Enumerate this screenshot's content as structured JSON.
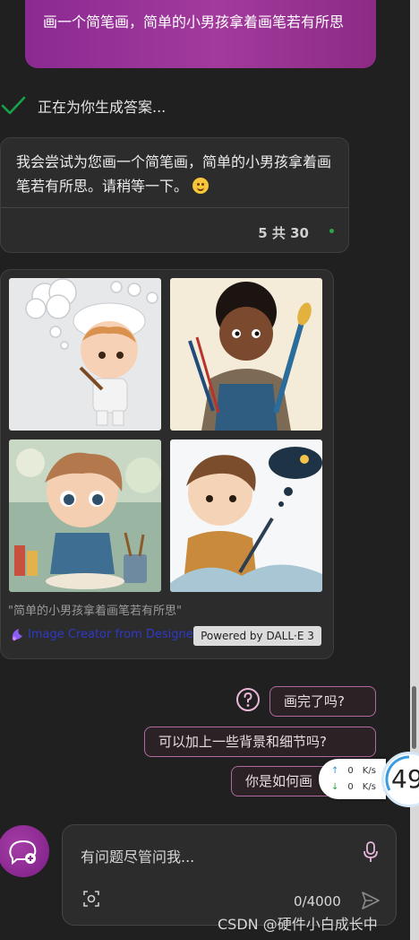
{
  "user_message": "画一个简笔画，简单的小男孩拿着画笔若有所思",
  "status": {
    "text": "正在为你生成答案..."
  },
  "answer": {
    "text": "我会尝试为您画一个简笔画，简单的小男孩拿着画笔若有所思。请稍等一下。",
    "page_count": "5 共 30"
  },
  "image_card": {
    "caption": "\"简单的小男孩拿着画笔若有所思\"",
    "creator_label": "Image Creator from Designer",
    "powered_by": "Powered by DALL·E 3"
  },
  "suggestions": [
    "画完了吗?",
    "可以加上一些背景和细节吗?",
    "你是如何画"
  ],
  "speed_meter": {
    "up": "0",
    "down": "0",
    "unit": "K/s",
    "gauge_value": "49"
  },
  "input": {
    "placeholder": "有问题尽管问我...",
    "char_count": "0/4000"
  },
  "watermark": "CSDN @硬件小白成长中",
  "colors": {
    "accent": "#9b2f96",
    "check": "#16a34a",
    "background": "#202020"
  }
}
